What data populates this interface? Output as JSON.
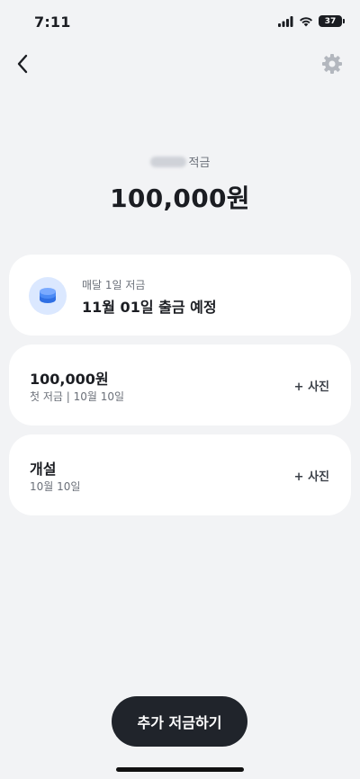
{
  "status": {
    "time": "7:11",
    "battery": "37"
  },
  "savings": {
    "name_suffix": "적금",
    "amount": "100,000원"
  },
  "schedule": {
    "caption": "매달 1일 저금",
    "next": "11월 01일 출금 예정"
  },
  "history": [
    {
      "title": "100,000원",
      "subtitle": "첫 저금 | 10월 10일",
      "action": "+ 사진"
    },
    {
      "title": "개설",
      "subtitle": "10월 10일",
      "action": "+ 사진"
    }
  ],
  "cta": {
    "label": "추가 저금하기"
  },
  "colors": {
    "background": "#f2f3f5",
    "card": "#ffffff",
    "accent": "#3b82f6",
    "cta": "#20242b"
  }
}
